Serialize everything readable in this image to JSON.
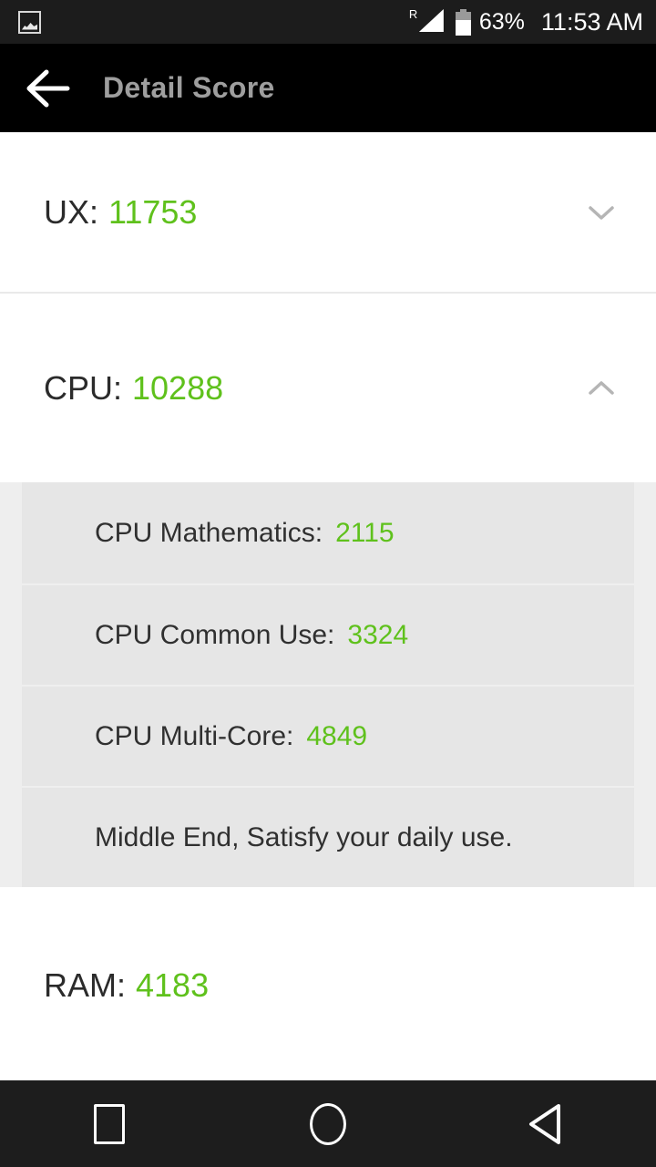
{
  "status_bar": {
    "notification_icon": "screenshot-image-icon",
    "roaming_indicator": "R",
    "signal_icon": "signal-triangle-icon",
    "battery_icon": "battery-icon",
    "battery_percent": "63%",
    "battery_level": 63,
    "time": "11:53 AM"
  },
  "app_bar": {
    "back_icon": "arrow-left-icon",
    "title": "Detail Score"
  },
  "sections": [
    {
      "id": "ux",
      "label": "UX:",
      "value": "11753",
      "expanded": false,
      "chevron": "chevron-down-icon"
    },
    {
      "id": "cpu",
      "label": "CPU:",
      "value": "10288",
      "expanded": true,
      "chevron": "chevron-up-icon",
      "details": [
        {
          "label": "CPU Mathematics:",
          "value": "2115"
        },
        {
          "label": "CPU Common Use:",
          "value": "3324"
        },
        {
          "label": "CPU Multi-Core:",
          "value": "4849"
        }
      ],
      "note": "Middle End, Satisfy your daily use."
    },
    {
      "id": "ram",
      "label": "RAM:",
      "value": "4183",
      "expanded": false,
      "chevron": ""
    }
  ],
  "nav_bar": {
    "recents_label": "recents-square-icon",
    "home_label": "home-circle-icon",
    "back_label": "back-triangle-icon"
  },
  "colors": {
    "score_green": "#5fc11c",
    "app_bar_bg": "#000000",
    "status_bar_bg": "#1c1c1c",
    "card_bg": "#e6e6e6",
    "page_bg": "#ffffff"
  }
}
